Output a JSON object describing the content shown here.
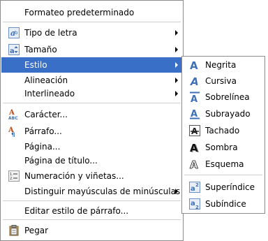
{
  "colors": {
    "highlight": "#3a6fc8",
    "menu_border": "#8c8c8c",
    "separator": "#cfcfcf",
    "icon_blue": "#3f6fb5"
  },
  "main_menu": {
    "items": [
      {
        "label": "Formateo predeterminado",
        "icon": null,
        "submenu": false
      },
      {
        "label": "Tipo de letra",
        "icon": "font-name-icon",
        "submenu": true
      },
      {
        "label": "Tamaño",
        "icon": "font-size-icon",
        "submenu": true
      },
      {
        "label": "Estilo",
        "icon": null,
        "submenu": true,
        "highlighted": true
      },
      {
        "label": "Alineación",
        "icon": null,
        "submenu": true
      },
      {
        "label": "Interlineado",
        "icon": null,
        "submenu": true
      },
      {
        "label": "Carácter...",
        "icon": "character-icon",
        "submenu": false
      },
      {
        "label": "Párrafo...",
        "icon": "paragraph-icon",
        "submenu": false
      },
      {
        "label": "Página...",
        "icon": null,
        "submenu": false
      },
      {
        "label": "Página de título...",
        "icon": null,
        "submenu": false
      },
      {
        "label": "Numeración y viñetas...",
        "icon": "numbering-icon",
        "submenu": false
      },
      {
        "label": "Distinguir mayúsculas de minúsculas",
        "icon": null,
        "submenu": true
      },
      {
        "label": "Editar estilo de párrafo...",
        "icon": null,
        "submenu": false
      },
      {
        "label": "Pegar",
        "icon": "paste-icon",
        "submenu": false
      }
    ]
  },
  "style_submenu": {
    "items": [
      {
        "label": "Negrita",
        "icon": "bold-icon"
      },
      {
        "label": "Cursiva",
        "icon": "italic-icon"
      },
      {
        "label": "Sobrelínea",
        "icon": "overline-icon"
      },
      {
        "label": "Subrayado",
        "icon": "underline-icon"
      },
      {
        "label": "Tachado",
        "icon": "strikethrough-icon"
      },
      {
        "label": "Sombra",
        "icon": "shadow-icon"
      },
      {
        "label": "Esquema",
        "icon": "outline-icon"
      },
      {
        "label": "Superíndice",
        "icon": "superscript-icon"
      },
      {
        "label": "Subíndice",
        "icon": "subscript-icon"
      }
    ]
  }
}
